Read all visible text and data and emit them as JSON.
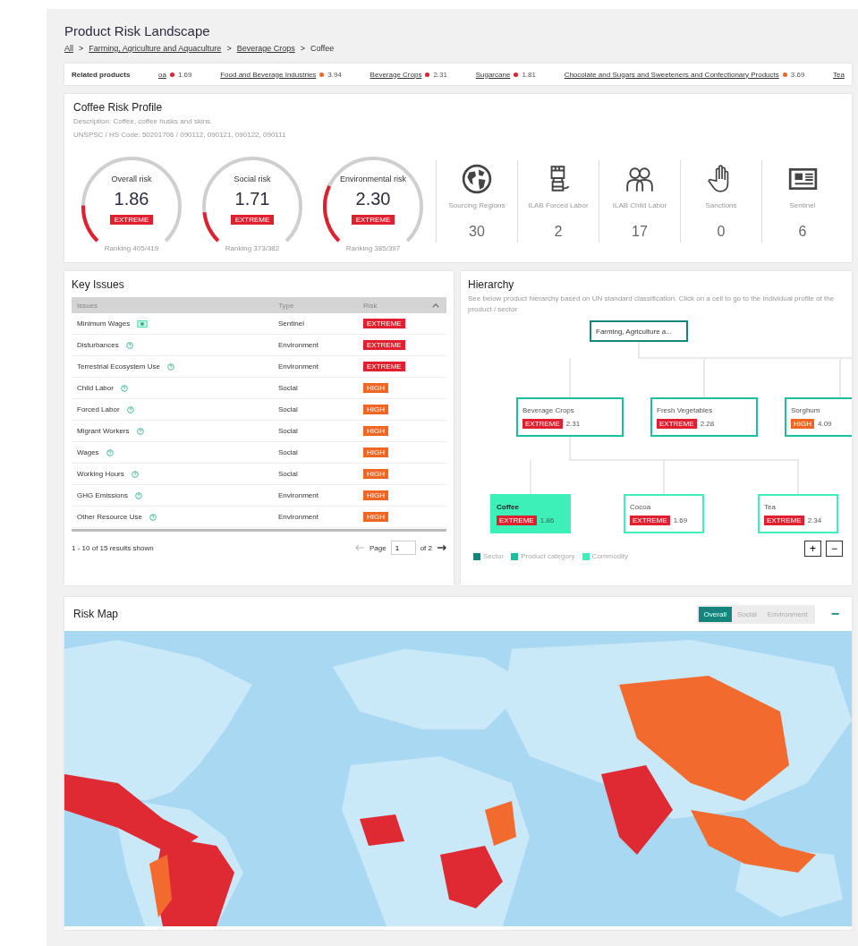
{
  "page": {
    "title": "Product Risk Landscape"
  },
  "breadcrumb": [
    "All",
    "Farming, Agriculture and Aquaculture",
    "Beverage Crops",
    "Coffee"
  ],
  "breadcrumb_separator": ">",
  "related_products": {
    "label": "Related products",
    "items": [
      {
        "name": "oa",
        "color": "#e0202f",
        "score": "1.69"
      },
      {
        "name": "Food and Beverage Industries",
        "color": "#f26522",
        "score": "3.94"
      },
      {
        "name": "Beverage Crops",
        "color": "#e0202f",
        "score": "2.31"
      },
      {
        "name": "Sugarcane",
        "color": "#e0202f",
        "score": "1.81"
      },
      {
        "name": "Chocolate and Sugars and Sweeteners and Confectionary Products",
        "color": "#f26522",
        "score": "3.69"
      },
      {
        "name": "Tea"
      }
    ]
  },
  "risk_profile": {
    "title": "Coffee Risk Profile",
    "description": "Description: Coffee, coffee husks and skins.",
    "codes": "UNSPSC / HS Code: 50201706 / 090112, 090121, 090122, 090111",
    "gauges": [
      {
        "label": "Overall risk",
        "value": "1.86",
        "badge": "EXTREME",
        "color": "#e0202f",
        "ranking": "Ranking 405/419"
      },
      {
        "label": "Social risk",
        "value": "1.71",
        "badge": "EXTREME",
        "color": "#e0202f",
        "ranking": "Ranking 373/382"
      },
      {
        "label": "Environmental risk",
        "value": "2.30",
        "badge": "EXTREME",
        "color": "#e0202f",
        "ranking": "Ranking 385/397"
      }
    ],
    "stats": [
      {
        "kind": "globe",
        "label": "Sourcing Regions",
        "value": "30"
      },
      {
        "kind": "fist",
        "label": "ILAB Forced Labor",
        "value": "2"
      },
      {
        "kind": "children",
        "label": "ILAB Child Labor",
        "value": "17"
      },
      {
        "kind": "hand",
        "label": "Sanctions",
        "value": "0"
      },
      {
        "kind": "newspaper",
        "label": "Sentinel",
        "value": "6"
      }
    ]
  },
  "key_issues": {
    "title": "Key Issues",
    "columns": [
      "Issues",
      "Type",
      "Risk"
    ],
    "rows": [
      {
        "issue": "Minimum Wages",
        "kind": "sentinel",
        "type": "Sentinel",
        "risk": "EXTREME",
        "color": "#e0202f"
      },
      {
        "issue": "Disturbances",
        "kind": "help",
        "type": "Environment",
        "risk": "EXTREME",
        "color": "#e0202f"
      },
      {
        "issue": "Terrestrial Ecosystem Use",
        "kind": "help",
        "type": "Environment",
        "risk": "EXTREME",
        "color": "#e0202f"
      },
      {
        "issue": "Child Labor",
        "kind": "help",
        "type": "Social",
        "risk": "HIGH",
        "color": "#f26522"
      },
      {
        "issue": "Forced Labor",
        "kind": "help",
        "type": "Social",
        "risk": "HIGH",
        "color": "#f26522"
      },
      {
        "issue": "Migrant Workers",
        "kind": "help",
        "type": "Social",
        "risk": "HIGH",
        "color": "#f26522"
      },
      {
        "issue": "Wages",
        "kind": "help",
        "type": "Social",
        "risk": "HIGH",
        "color": "#f26522"
      },
      {
        "issue": "Working Hours",
        "kind": "help",
        "type": "Social",
        "risk": "HIGH",
        "color": "#f26522"
      },
      {
        "issue": "GHG Emissions",
        "kind": "help",
        "type": "Environment",
        "risk": "HIGH",
        "color": "#f26522"
      },
      {
        "issue": "Other Resource Use",
        "kind": "help",
        "type": "Environment",
        "risk": "HIGH",
        "color": "#f26522"
      }
    ],
    "summary": "1 - 10 of 15 results shown",
    "page_label": "Page",
    "page_value": "1",
    "page_total": "of 2"
  },
  "hierarchy": {
    "title": "Hierarchy",
    "description": "See below product hierarchy based on UN standard classification. Click on a cell to go to the individual profile of the product / sector",
    "tree": {
      "label": "Farming, Agriculture a...",
      "kind": "sector",
      "selected": false,
      "children": [
        {
          "label": "Beverage Crops",
          "kind": "category",
          "selected": false,
          "risk": "EXTREME",
          "color": "#e0202f",
          "score": "2.31",
          "children": [
            {
              "label": "Coffee",
              "kind": "commodity",
              "selected": true,
              "risk": "EXTREME",
              "color": "#e0202f",
              "score": "1.86"
            },
            {
              "label": "Cocoa",
              "kind": "commodity",
              "selected": false,
              "risk": "EXTREME",
              "color": "#e0202f",
              "score": "1.69"
            },
            {
              "label": "Tea",
              "kind": "commodity",
              "selected": false,
              "risk": "EXTREME",
              "color": "#e0202f",
              "score": "2.34"
            }
          ]
        },
        {
          "label": "Fresh Vegetables",
          "kind": "category",
          "selected": false,
          "risk": "EXTREME",
          "color": "#e0202f",
          "score": "2.28"
        },
        {
          "label": "Sorghum",
          "kind": "category",
          "selected": false,
          "risk": "HIGH",
          "color": "#f26522",
          "score": "4.09"
        }
      ]
    },
    "legend": [
      {
        "label": "Sector",
        "color": "#13857c"
      },
      {
        "label": "Product category",
        "color": "#1bbf9c"
      },
      {
        "label": "Commodity",
        "color": "#3df0b8"
      }
    ],
    "zoom_in": "+",
    "zoom_out": "−"
  },
  "risk_map": {
    "title": "Risk Map",
    "tabs": [
      {
        "label": "Overall",
        "selected": true
      },
      {
        "label": "Social",
        "selected": false
      },
      {
        "label": "Environment",
        "selected": false
      }
    ],
    "collapse": "−"
  }
}
